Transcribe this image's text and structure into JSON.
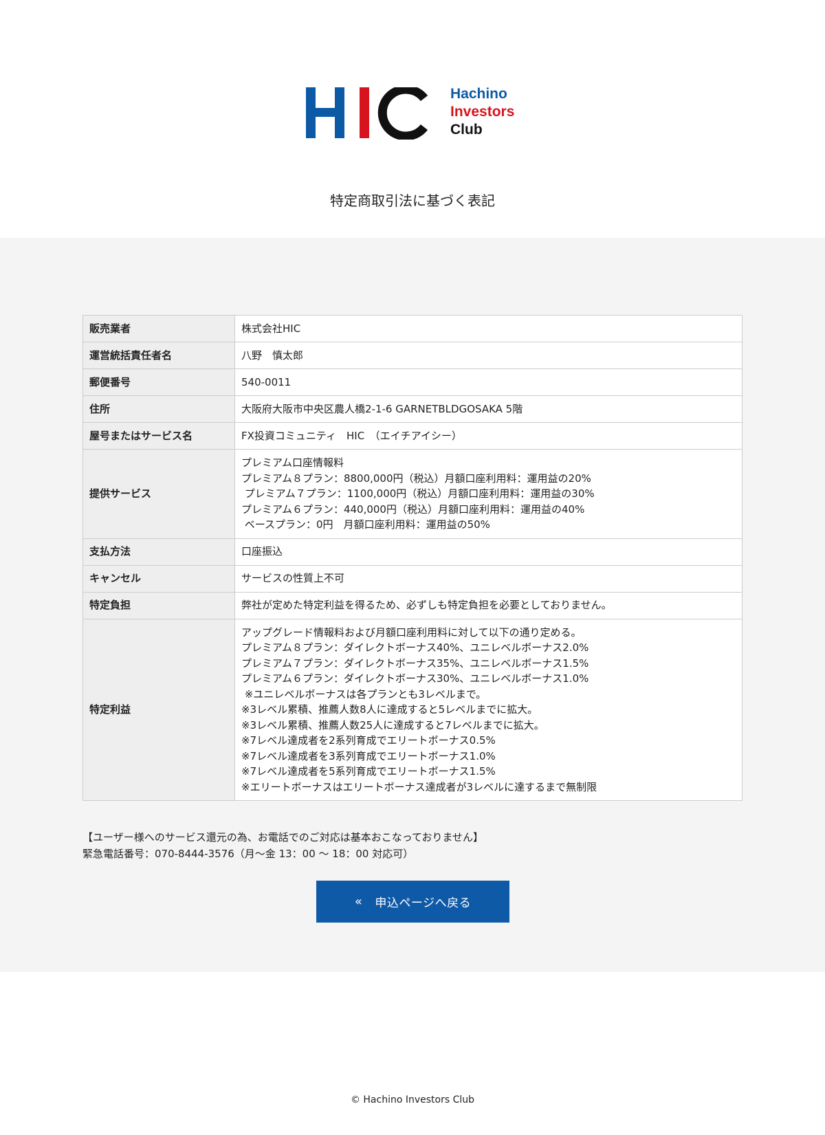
{
  "logo": {
    "mark": "HIC",
    "line1": "Hachino",
    "line2": "Investors",
    "line3": "Club",
    "colors": {
      "blue": "#0c5aa6",
      "red": "#d7141e",
      "black": "#111111"
    }
  },
  "page_title": "特定商取引法に基づく表記",
  "table": {
    "rows": [
      {
        "label": "販売業者",
        "lines": [
          "株式会社HIC"
        ]
      },
      {
        "label": "運営統括責任者名",
        "lines": [
          "八野　慎太郎"
        ]
      },
      {
        "label": "郵便番号",
        "lines": [
          "540-0011"
        ]
      },
      {
        "label": "住所",
        "lines": [
          "大阪府大阪市中央区農人橋2-1-6 GARNETBLDGOSAKA 5階"
        ]
      },
      {
        "label": "屋号またはサービス名",
        "lines": [
          "FX投資コミュニティ　HIC　（エイチアイシー）"
        ]
      },
      {
        "label": "提供サービス",
        "lines": [
          "プレミアム口座情報料",
          "プレミアム８プラン：8800,000円（税込）月額口座利用料：運用益の20%",
          " プレミアム７プラン：1100,000円（税込）月額口座利用料：運用益の30%",
          "プレミアム６プラン：440,000円（税込）月額口座利用料：運用益の40%",
          " ベースプラン：0円　月額口座利用料：運用益の50%"
        ]
      },
      {
        "label": "支払方法",
        "lines": [
          "口座振込"
        ]
      },
      {
        "label": "キャンセル",
        "lines": [
          "サービスの性質上不可"
        ]
      },
      {
        "label": "特定負担",
        "lines": [
          "弊社が定めた特定利益を得るため、必ずしも特定負担を必要としておりません。"
        ]
      },
      {
        "label": "特定利益",
        "lines": [
          "アップグレード情報料および月額口座利用料に対して以下の通り定める。",
          "プレミアム８プラン：ダイレクトボーナス40%、ユニレベルボーナス2.0%",
          "プレミアム７プラン：ダイレクトボーナス35%、ユニレベルボーナス1.5%",
          "プレミアム６プラン：ダイレクトボーナス30%、ユニレベルボーナス1.0%",
          " ※ユニレベルボーナスは各プランとも3レベルまで。",
          "※3レベル累積、推薦人数8人に達成すると5レベルまでに拡大。",
          "※3レベル累積、推薦人数25人に達成すると7レベルまでに拡大。",
          "※7レベル達成者を2系列育成でエリートボーナス0.5%",
          "※7レベル達成者を3系列育成でエリートボーナス1.0%",
          "※7レベル達成者を5系列育成でエリートボーナス1.5%",
          "※エリートボーナスはエリートボーナス達成者が3レベルに達するまで無制限"
        ]
      }
    ]
  },
  "notice": {
    "line1": "【ユーザー様へのサービス還元の為、お電話でのご対応は基本おこなっておりません】",
    "line2": "緊急電話番号：070-8444-3576（月～金 13：00 ～ 18：00 対応可）"
  },
  "back_button": {
    "icon": "«",
    "icon_name": "double-chevron-left-icon",
    "label": "申込ページへ戻る",
    "color": "#0f5aa7"
  },
  "footer": {
    "copyright": "© Hachino Investors Club"
  }
}
